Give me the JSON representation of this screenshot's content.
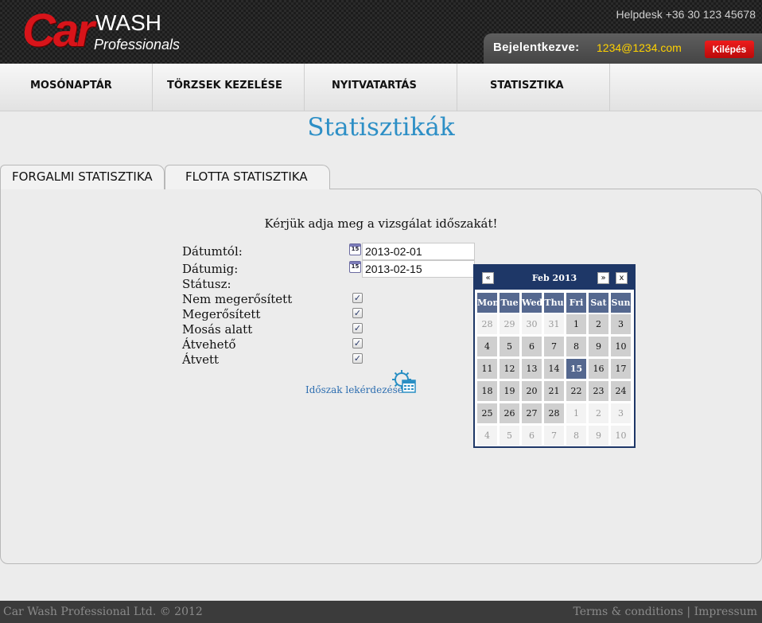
{
  "header": {
    "logo_car": "Car",
    "logo_wash": "WASH",
    "logo_professionals": "Professionals",
    "helpdesk": "Helpdesk +36 30 123 45678",
    "login_label": "Bejelentkezve:",
    "login_email": "1234@1234.com",
    "logout_label": "Kilépés"
  },
  "nav": {
    "items": [
      "MOSÓNAPTÁR",
      "TÖRZSEK KEZELÉSE",
      "NYITVATARTÁS",
      "STATISZTIKA"
    ]
  },
  "page_title": "Statisztikák",
  "tabs": [
    "FORGALMI STATISZTIKA",
    "FLOTTA STATISZTIKA"
  ],
  "form": {
    "instruction": "Kérjük adja meg a vizsgálat időszakát!",
    "date_from_label": "Dátumtól:",
    "date_from_value": "2013-02-01",
    "date_to_label": "Dátumig:",
    "date_to_value": "2013-02-15",
    "status_label": "Státusz:",
    "statuses": [
      {
        "label": "Nem megerősített",
        "checked": true
      },
      {
        "label": "Megerősített",
        "checked": true
      },
      {
        "label": "Mosás alatt",
        "checked": true
      },
      {
        "label": "Átvehető",
        "checked": true
      },
      {
        "label": "Átvett",
        "checked": true
      }
    ],
    "query_link": "Időszak lekérdezése",
    "calendar_icon_text": "15"
  },
  "calendar": {
    "month_label": "Feb 2013",
    "prev": "«",
    "next": "»",
    "close": "x",
    "weekdays": [
      "Mon",
      "Tue",
      "Wed",
      "Thu",
      "Fri",
      "Sat",
      "Sun"
    ],
    "weeks": [
      [
        "28",
        "29",
        "30",
        "31",
        "1",
        "2",
        "3"
      ],
      [
        "4",
        "5",
        "6",
        "7",
        "8",
        "9",
        "10"
      ],
      [
        "11",
        "12",
        "13",
        "14",
        "15",
        "16",
        "17"
      ],
      [
        "18",
        "19",
        "20",
        "21",
        "22",
        "23",
        "24"
      ],
      [
        "25",
        "26",
        "27",
        "28",
        "1",
        "2",
        "3"
      ],
      [
        "4",
        "5",
        "6",
        "7",
        "8",
        "9",
        "10"
      ]
    ],
    "selected_day": "15"
  },
  "footer": {
    "copyright": "Car Wash Professional Ltd. © 2012",
    "terms": "Terms & conditions",
    "separator": "|",
    "impressum": "Impressum"
  },
  "colors": {
    "title_blue": "#2d8fc6",
    "calendar_navy": "#1e3767",
    "logout_red": "#d81414",
    "email_yellow": "#ffd200"
  }
}
